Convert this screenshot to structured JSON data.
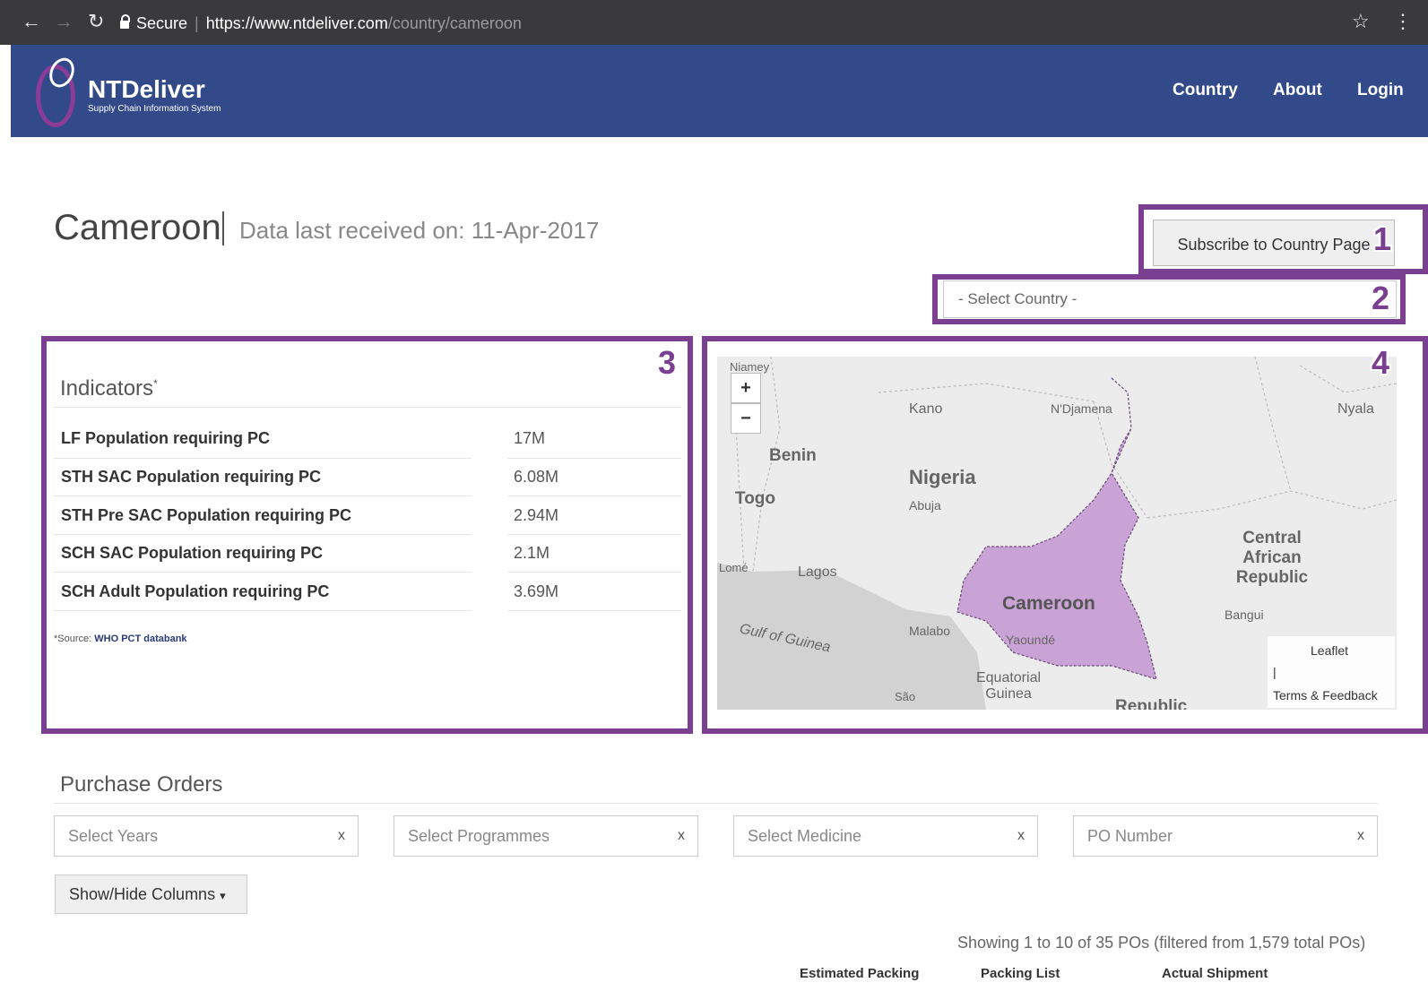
{
  "browser": {
    "secure_label": "Secure",
    "url_host": "https://www.ntdeliver.com",
    "url_path": "/country/cameroon"
  },
  "header": {
    "brand": "NTDeliver",
    "tagline": "Supply Chain Information System",
    "nav": [
      "Country",
      "About",
      "Login"
    ]
  },
  "page": {
    "country": "Cameroon",
    "last_received": "Data last received on: 11-Apr-2017",
    "subscribe_label": "Subscribe to Country Page",
    "select_country_placeholder": "- Select Country -"
  },
  "annotations": [
    "1",
    "2",
    "3",
    "4"
  ],
  "indicators": {
    "title": "Indicators",
    "title_mark": "*",
    "rows": [
      {
        "label": "LF Population requiring PC",
        "value": "17M"
      },
      {
        "label": "STH SAC Population requiring PC",
        "value": "6.08M"
      },
      {
        "label": "STH Pre SAC Population requiring PC",
        "value": "2.94M"
      },
      {
        "label": "SCH SAC Population requiring PC",
        "value": "2.1M"
      },
      {
        "label": "SCH Adult Population requiring PC",
        "value": "3.69M"
      }
    ],
    "source_prefix": "*Source:",
    "source_link": "WHO PCT databank"
  },
  "map": {
    "labels": {
      "niamey": "Niamey",
      "kano": "Kano",
      "ndjamena": "N'Djamena",
      "nyala": "Nyala",
      "benin": "Benin",
      "nigeria": "Nigeria",
      "abuja": "Abuja",
      "togo": "Togo",
      "lome": "Lomé",
      "lagos": "Lagos",
      "car": "Central African Republic",
      "cameroon": "Cameroon",
      "bangui": "Bangui",
      "malabo": "Malabo",
      "yaounde": "Yaoundé",
      "gulf": "Gulf of Guinea",
      "eq_guinea": "Equatorial Guinea",
      "sao": "São",
      "republic": "Republic"
    },
    "zoom_in": "+",
    "zoom_out": "−",
    "attribution_leaflet": "Leaflet",
    "attribution_sep": "|",
    "attribution_terms": "Terms & Feedback",
    "colors": {
      "highlight": "#c9a3d6",
      "highlight_stroke": "#6a4a7a",
      "water": "#d2d2d2",
      "land": "#ececec"
    }
  },
  "purchase_orders": {
    "title": "Purchase Orders",
    "filters": [
      {
        "placeholder": "Select Years"
      },
      {
        "placeholder": "Select Programmes"
      },
      {
        "placeholder": "Select Medicine"
      },
      {
        "placeholder": "PO Number"
      }
    ],
    "clear_glyph": "x",
    "show_hide_label": "Show/Hide Columns",
    "caret": "▾",
    "showing": "Showing 1 to 10 of 35 POs (filtered from 1,579 total POs)",
    "column_heads": [
      "Estimated Packing",
      "Packing List",
      "Actual Shipment"
    ]
  },
  "theme": {
    "header_bg": "#334a8a",
    "annotation_purple": "#7b3f91"
  }
}
